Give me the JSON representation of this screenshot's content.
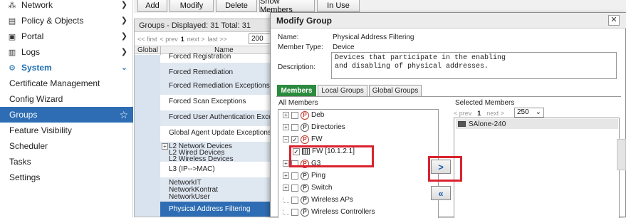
{
  "sidebar": {
    "items": [
      {
        "label": "Network",
        "icon": "network-icon"
      },
      {
        "label": "Policy & Objects",
        "icon": "document-icon"
      },
      {
        "label": "Portal",
        "icon": "portal-icon"
      },
      {
        "label": "Logs",
        "icon": "chart-icon"
      },
      {
        "label": "System",
        "icon": "gear-icon"
      }
    ],
    "system_children": [
      {
        "label": "Certificate Management"
      },
      {
        "label": "Config Wizard"
      },
      {
        "label": "Groups"
      },
      {
        "label": "Feature Visibility"
      },
      {
        "label": "Scheduler"
      },
      {
        "label": "Tasks"
      },
      {
        "label": "Settings"
      }
    ]
  },
  "toolbar": {
    "add": "Add",
    "modify": "Modify",
    "delete": "Delete",
    "show_members": "Show Members",
    "in_use": "In Use"
  },
  "groups_panel": {
    "header": "Groups - Displayed: 31 Total: 31",
    "pager": {
      "first": "<< first",
      "prev": "< prev",
      "page": "1",
      "next": "next >",
      "last": "last >>",
      "size": "200"
    },
    "col_global": "Global",
    "col_name": "Name",
    "rows": [
      "Forced Registration",
      "Forced Remediation",
      "Forced Remediation Exceptions",
      "Forced Scan Exceptions",
      "Forced User Authentication Exceptions",
      "Global Agent Update Exceptions",
      "L2 Network Devices",
      "L2 Wired Devices",
      "L2 Wireless Devices",
      "L3 (IP-->MAC)",
      "NetworkIT",
      "NetworkKontrat",
      "NetworkUser",
      "Physical Address Filtering"
    ]
  },
  "dialog": {
    "title": "Modify Group",
    "close": "✕",
    "name_label": "Name:",
    "name_value": "Physical Address Filtering",
    "type_label": "Member Type:",
    "type_value": "Device",
    "desc_label": "Description:",
    "desc_value": "Devices that participate in the enabling\nand disabling of physical addresses.",
    "tabs": [
      "Members",
      "Local Groups",
      "Global Groups"
    ],
    "all_members_label": "All Members",
    "selected_members_label": "Selected Members",
    "tree": [
      {
        "label": "Deb",
        "icon": "P",
        "expand": "+"
      },
      {
        "label": "Directories",
        "icon": "P",
        "expand": "+"
      },
      {
        "label": "FW",
        "icon": "P",
        "expand": "−"
      },
      {
        "label": "FW [10.1.2.1]",
        "icon": "device",
        "expand": ""
      },
      {
        "label": "G3",
        "icon": "P",
        "expand": "+"
      },
      {
        "label": "Ping",
        "icon": "P",
        "expand": "+"
      },
      {
        "label": "Switch",
        "icon": "P",
        "expand": "+"
      },
      {
        "label": "Wireless APs",
        "icon": "P",
        "expand": ""
      },
      {
        "label": "Wireless Controllers",
        "icon": "P",
        "expand": ""
      }
    ],
    "sel_pager": {
      "prev": "< prev",
      "page": "1",
      "next": "next >",
      "size": "250"
    },
    "selected": [
      "SAlone-240"
    ],
    "add_arrow": ">",
    "remove_all_arrow": "«"
  },
  "colors": {
    "accent": "#2e6db4",
    "tab_active": "#2b8a3e",
    "highlight": "#d9232e"
  }
}
